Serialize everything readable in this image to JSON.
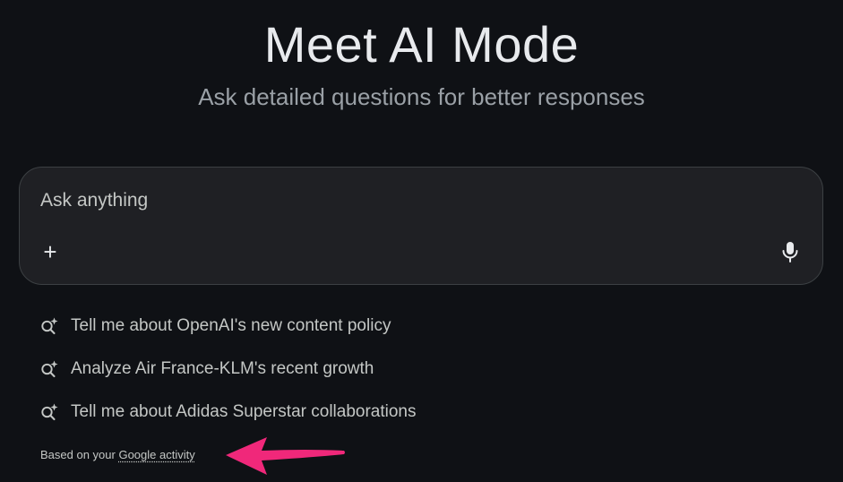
{
  "header": {
    "title": "Meet AI Mode",
    "subtitle": "Ask detailed questions for better responses"
  },
  "search": {
    "placeholder": "Ask anything",
    "value": "",
    "plus_label": "+",
    "plus_icon": "plus-icon",
    "mic_icon": "microphone-icon"
  },
  "suggestions": [
    {
      "icon": "search-sparkle-icon",
      "label": "Tell me about OpenAI's new content policy"
    },
    {
      "icon": "search-sparkle-icon",
      "label": "Analyze Air France-KLM's recent growth"
    },
    {
      "icon": "search-sparkle-icon",
      "label": "Tell me about Adidas Superstar collaborations"
    }
  ],
  "footer": {
    "prefix": "Based on your",
    "link_label": "Google activity"
  },
  "annotation": {
    "icon": "pointer-arrow-icon",
    "color": "#f0287a"
  },
  "colors": {
    "background": "#0f1115",
    "box_background": "#1f2024",
    "box_border": "#3c4043",
    "text_primary": "#e8eaed",
    "text_secondary": "#9aa0a6"
  }
}
